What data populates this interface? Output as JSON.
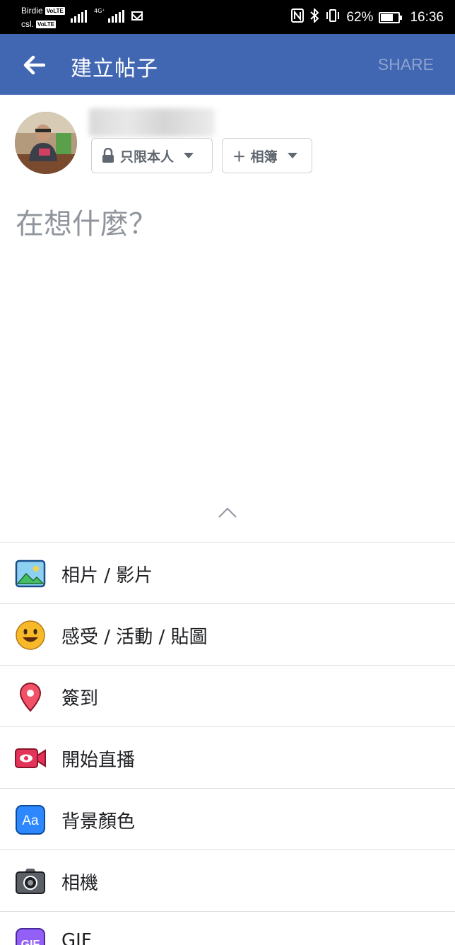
{
  "status_bar": {
    "carrier_1": "Birdie",
    "carrier_2": "csl.",
    "volte_label": "VoLTE",
    "network_type": "4G⁺",
    "battery_percent": "62%",
    "battery_level": 0.62,
    "time": "16:36",
    "icons": [
      "signal-icon",
      "mail-icon",
      "nfc-icon",
      "bluetooth-icon",
      "vibrate-icon",
      "battery-icon"
    ]
  },
  "app_bar": {
    "title": "建立帖子",
    "share_label": "SHARE",
    "background_color": "#4267b2"
  },
  "composer": {
    "privacy_label": "只限本人",
    "album_label": "＋ 相簿",
    "placeholder": "在想什麼？"
  },
  "actions": [
    {
      "id": "photo-video",
      "label": "相片 / 影片",
      "icon": "photo-icon"
    },
    {
      "id": "feeling",
      "label": "感受 / 活動 / 貼圖",
      "icon": "smiley-icon"
    },
    {
      "id": "check-in",
      "label": "簽到",
      "icon": "location-pin-icon"
    },
    {
      "id": "live",
      "label": "開始直播",
      "icon": "live-video-icon"
    },
    {
      "id": "background",
      "label": "背景顏色",
      "icon": "text-background-icon"
    },
    {
      "id": "camera",
      "label": "相機",
      "icon": "camera-icon"
    },
    {
      "id": "gif",
      "label": "GIF",
      "icon": "gif-icon"
    }
  ]
}
